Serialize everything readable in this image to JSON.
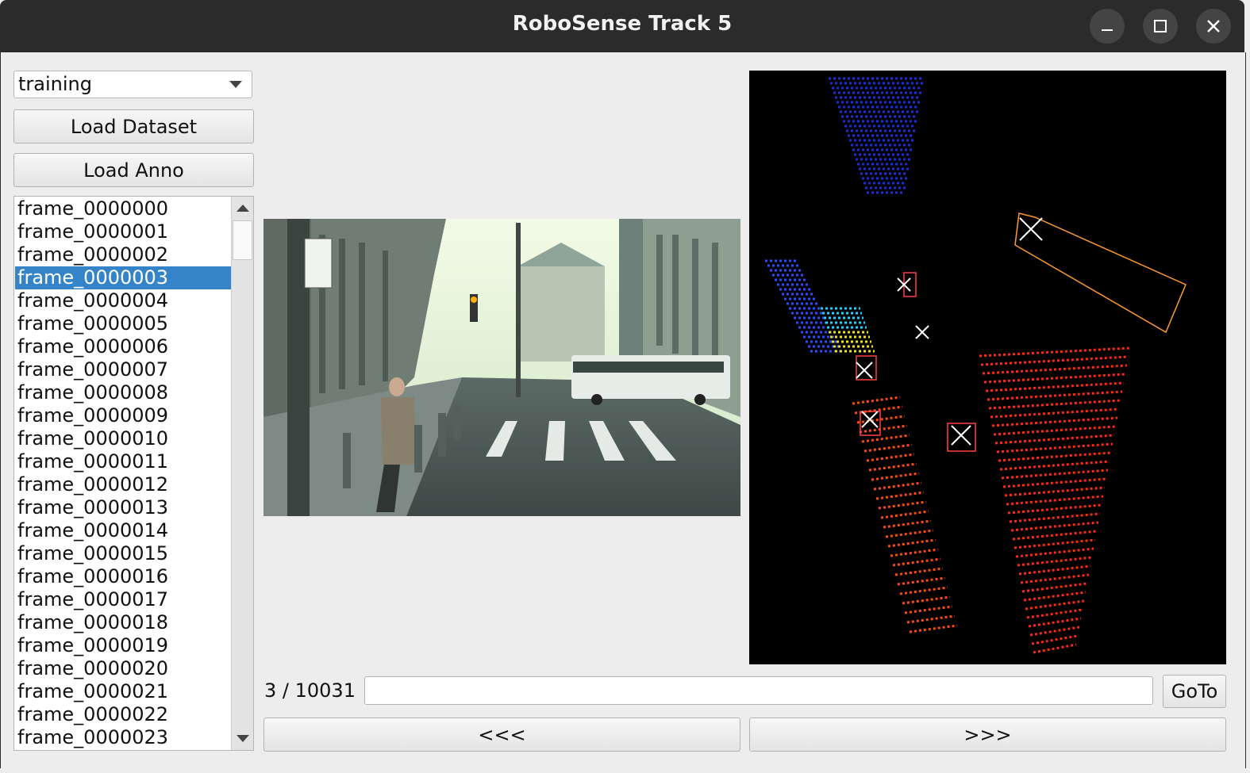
{
  "window": {
    "title": "RoboSense Track 5",
    "controls": [
      "minimize-icon",
      "maximize-icon",
      "close-icon"
    ]
  },
  "split_select": {
    "selected": "training"
  },
  "buttons": {
    "load_dataset": "Load Dataset",
    "load_anno": "Load Anno",
    "goto": "GoTo",
    "prev": "<<<",
    "next": ">>>"
  },
  "frames": {
    "items": [
      "frame_0000000",
      "frame_0000001",
      "frame_0000002",
      "frame_0000003",
      "frame_0000004",
      "frame_0000005",
      "frame_0000006",
      "frame_0000007",
      "frame_0000008",
      "frame_0000009",
      "frame_0000010",
      "frame_0000011",
      "frame_0000012",
      "frame_0000013",
      "frame_0000014",
      "frame_0000015",
      "frame_0000016",
      "frame_0000017",
      "frame_0000018",
      "frame_0000019",
      "frame_0000020",
      "frame_0000021",
      "frame_0000022",
      "frame_0000023"
    ],
    "selected_index": 3
  },
  "navigation": {
    "counter": "3 / 10031",
    "goto_value": ""
  },
  "colors": {
    "titlebar": "#2b2b2b",
    "selection": "#3584c9",
    "window_bg": "#ededed"
  }
}
